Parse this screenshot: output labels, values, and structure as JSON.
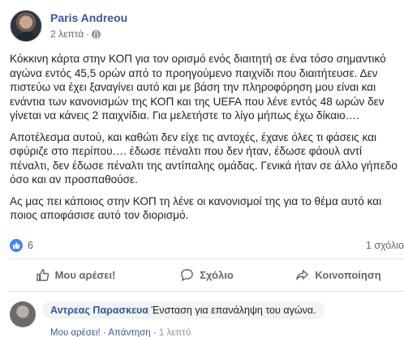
{
  "post": {
    "author": "Paris Andreou",
    "time": "2 λεπτά",
    "paragraphs": [
      "Κόκκινη κάρτα στην ΚΟΠ για τον ορισμό ενός διαιτητή σε ένα τόσο σημαντικό αγώνα εντός 45,5 ορών από το προηγούμενο παιχνίδι που διαιτήτευσε. Δεν πιστεύω να έχει ξαναγίνει αυτό και με βάση την πληροφόρηση μου είναι και ενάντια των κανονισμών της ΚΟΠ και της UEFA που λένε εντός 48 ωρών δεν γίνεται να κάνεις 2 παιχνίδια. Για μελετήστε το λίγο μήπως έχω δίκαιο….",
      "Αποτέλεσμα αυτού, και καθώτι δεν είχε τις αντοχές, έχανε όλες τι φάσεις και σφύριζε στο περίπου…. έδωσε πέναλτι που δεν ήταν, έδωσε φάουλ αντί πέναλτι, δεν έδωσε πέναλτι της αντίπαλης ομάδας. Γενικά ήταν σε άλλο γήπεδο όσο και αν προσπαθούσε.",
      "Ας μας πει κάποιος στην ΚΟΠ τη λένε οι κανονισμοί της για το θέμα αυτό και ποιος αποφάσισε αυτό τον διορισμό."
    ],
    "like_count": "6",
    "comment_count": "1 σχόλιο"
  },
  "actions": {
    "like": "Μου αρέσει!",
    "comment": "Σχόλιο",
    "share": "Κοινοποίηση"
  },
  "comment": {
    "author": "Αντρεας Παρασκευα",
    "text": "Ένσταση για επανάληψη του αγώνα.",
    "like": "Μου αρέσει!",
    "reply": "Απάντηση",
    "time": "1 λεπτό"
  },
  "colors": {
    "link": "#385898",
    "secondary_text": "#606770",
    "like_blue": "#3b8af5",
    "divider": "#dadde1"
  }
}
